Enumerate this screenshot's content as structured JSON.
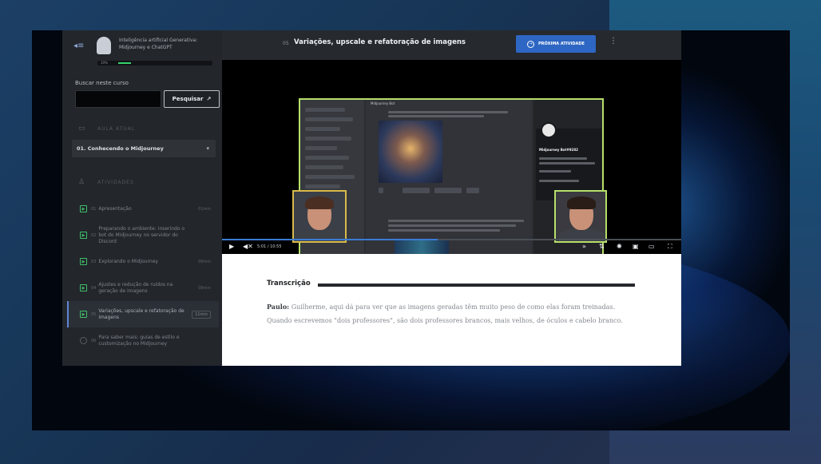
{
  "course": {
    "title": "Inteligência artificial Generativa: Midjourney e ChatGPT",
    "progress_label": "10%",
    "progress": 0.14
  },
  "search": {
    "label": "Buscar neste curso",
    "button": "Pesquisar"
  },
  "sections": {
    "current_lesson": "AULA ATUAL",
    "activities": "ATIVIDADES"
  },
  "lesson_select": {
    "value": "01. Conhecendo o Midjourney"
  },
  "activities": [
    {
      "num": "01",
      "label": "Apresentação",
      "time": "01min",
      "status": "done"
    },
    {
      "num": "02",
      "label": "Preparando o ambiente: inserindo o bot do Midjourney no servidor do Discord",
      "time": "",
      "status": "done"
    },
    {
      "num": "03",
      "label": "Explorando o Midjourney",
      "time": "06min",
      "status": "done"
    },
    {
      "num": "04",
      "label": "Ajustes e redução de ruídos na geração de imagens",
      "time": "08min",
      "status": "done"
    },
    {
      "num": "05",
      "label": "Variações, upscale e refatoração de imagens",
      "time": "11min",
      "status": "active"
    },
    {
      "num": "06",
      "label": "Para saber mais: guias de estilo e customização no Midjourney",
      "time": "",
      "status": "open"
    }
  ],
  "header": {
    "lesson_number": "05",
    "lesson_title": "Variações, upscale e refatoração de imagens",
    "next_button": "PRÓXIMA ATIVIDADE"
  },
  "video": {
    "time": "5:01 / 10:55",
    "played": 0.47,
    "discord_channel": "Midjourney Bot",
    "discord_profile": "Midjourney Bot#9282"
  },
  "transcript": {
    "heading": "Transcrição",
    "speaker": "Paulo:",
    "text": "Guilherme, aqui dá para ver que as imagens geradas têm muito peso de como elas foram treinadas. Quando escrevemos \"dois professores\", são dois professores brancos, mais velhos, de óculos e cabelo branco."
  },
  "colors": {
    "accent": "#2e66c3",
    "progress": "#36d26b",
    "cam_border_green": "#b6df6a",
    "cam_border_yellow": "#d9b94a"
  }
}
